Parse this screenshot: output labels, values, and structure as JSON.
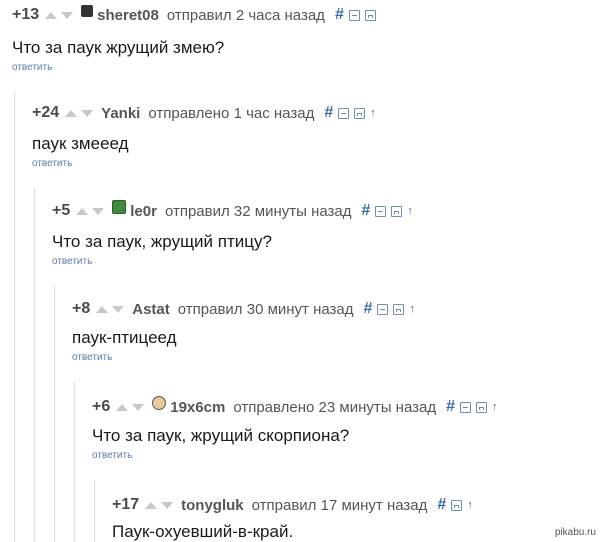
{
  "comments": [
    {
      "rating": "+13",
      "username": "sheret08",
      "action": "отправил",
      "time": "2 часа назад",
      "text": "Что за паук жрущий змею?",
      "reply_label": "ответить"
    },
    {
      "rating": "+24",
      "username": "Yanki",
      "action": "отправлено",
      "time": "1 час назад",
      "text": "паук змееед",
      "reply_label": "ответить"
    },
    {
      "rating": "+5",
      "username": "le0r",
      "action": "отправил",
      "time": "32 минуты назад",
      "text": "Что за паук, жрущий птицу?",
      "reply_label": "ответить"
    },
    {
      "rating": "+8",
      "username": "Astat",
      "action": "отправил",
      "time": "30 минут назад",
      "text": "паук-птицеед",
      "reply_label": "ответить"
    },
    {
      "rating": "+6",
      "username": "19x6cm",
      "action": "отправлено",
      "time": "23 минуты назад",
      "text": "Что за паук, жрущий скорпиона?",
      "reply_label": "ответить"
    },
    {
      "rating": "+17",
      "username": "tonygluk",
      "action": "отправил",
      "time": "17 минут назад",
      "text": "Паук-охуевший-в-край."
    }
  ],
  "tools": {
    "hash": "#",
    "parent_arrow": "↑"
  },
  "watermark": "pikabu.ru"
}
